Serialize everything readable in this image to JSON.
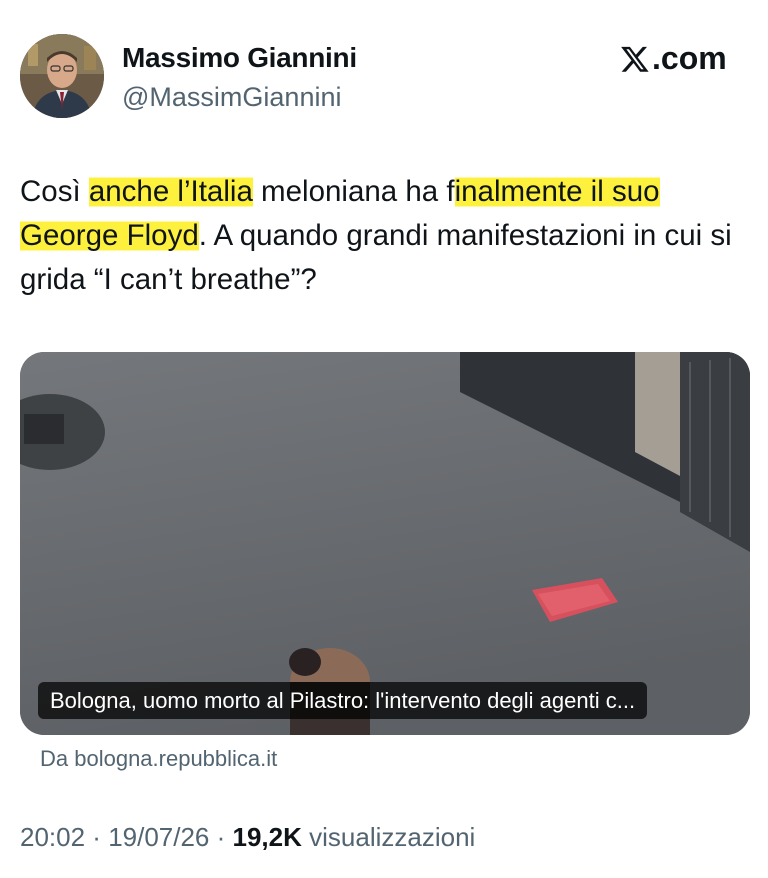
{
  "author": {
    "name": "Massimo Giannini",
    "handle": "@MassimGiannini"
  },
  "brand": {
    "label": ".com",
    "icon": "x-logo-icon"
  },
  "tweet": {
    "text_parts": [
      "Così ",
      "anche l’Italia",
      " meloniana ha f",
      "inalmente il suo",
      " ",
      "George Floyd",
      ". A quando grandi manifestazioni in cui si grida “I can’t breathe”?"
    ],
    "highlight_color": "#fdf13e"
  },
  "media": {
    "caption": "Bologna, uomo morto al Pilastro: l'intervento degli agenti c...",
    "source": "Da bologna.repubblica.it"
  },
  "meta": {
    "time": "20:02",
    "separator": " · ",
    "date": "19/07/26",
    "views_count": "19,2K",
    "views_label": "visualizzazioni"
  }
}
